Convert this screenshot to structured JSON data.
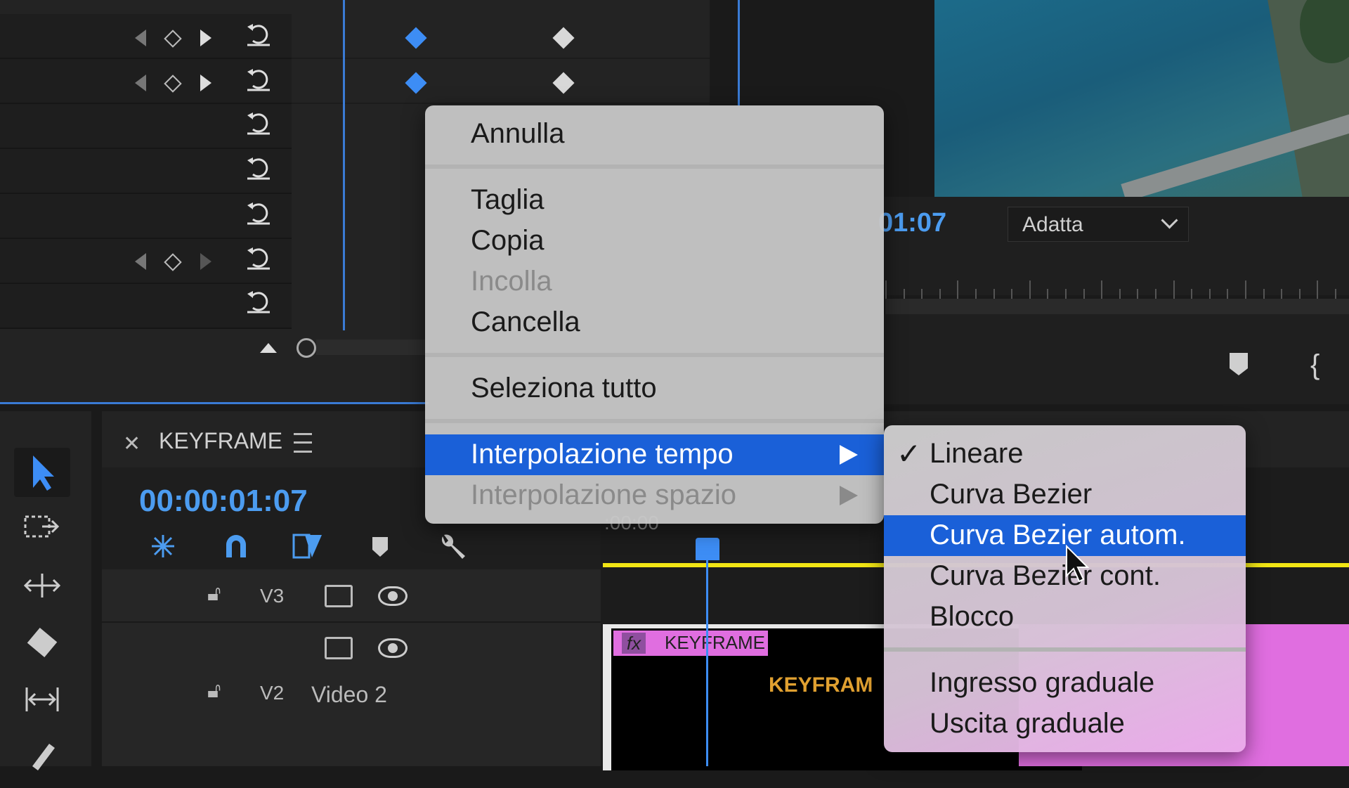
{
  "program_monitor": {
    "timecode": "01:07",
    "fit_select": "Adatta"
  },
  "sequence": {
    "name": "KEYFRAME",
    "timecode": "00:00:01:07",
    "ruler_label": ":00:00"
  },
  "tracks": [
    {
      "label": "V3"
    },
    {
      "label": "V2",
      "name": "Video 2"
    }
  ],
  "clip": {
    "fx_badge": "fx",
    "name": "KEYFRAME",
    "title_text": "KEYFRAM"
  },
  "context_menu": {
    "undo": "Annulla",
    "cut": "Taglia",
    "copy": "Copia",
    "paste": "Incolla",
    "clear": "Cancella",
    "select_all": "Seleziona tutto",
    "temporal_interpolation": "Interpolazione tempo",
    "spatial_interpolation": "Interpolazione spazio"
  },
  "submenu": {
    "check_mark": "✓",
    "linear": "Lineare",
    "bezier": "Curva Bezier",
    "auto_bezier": "Curva Bezier autom.",
    "continuous_bezier": "Curva Bezier cont.",
    "hold": "Blocco",
    "ease_in": "Ingresso graduale",
    "ease_out": "Uscita graduale"
  },
  "colors": {
    "accent_blue": "#3d8df5",
    "highlight": "#1a60d8",
    "work_area": "#f1e514",
    "clip_pink": "#e06ee0"
  }
}
